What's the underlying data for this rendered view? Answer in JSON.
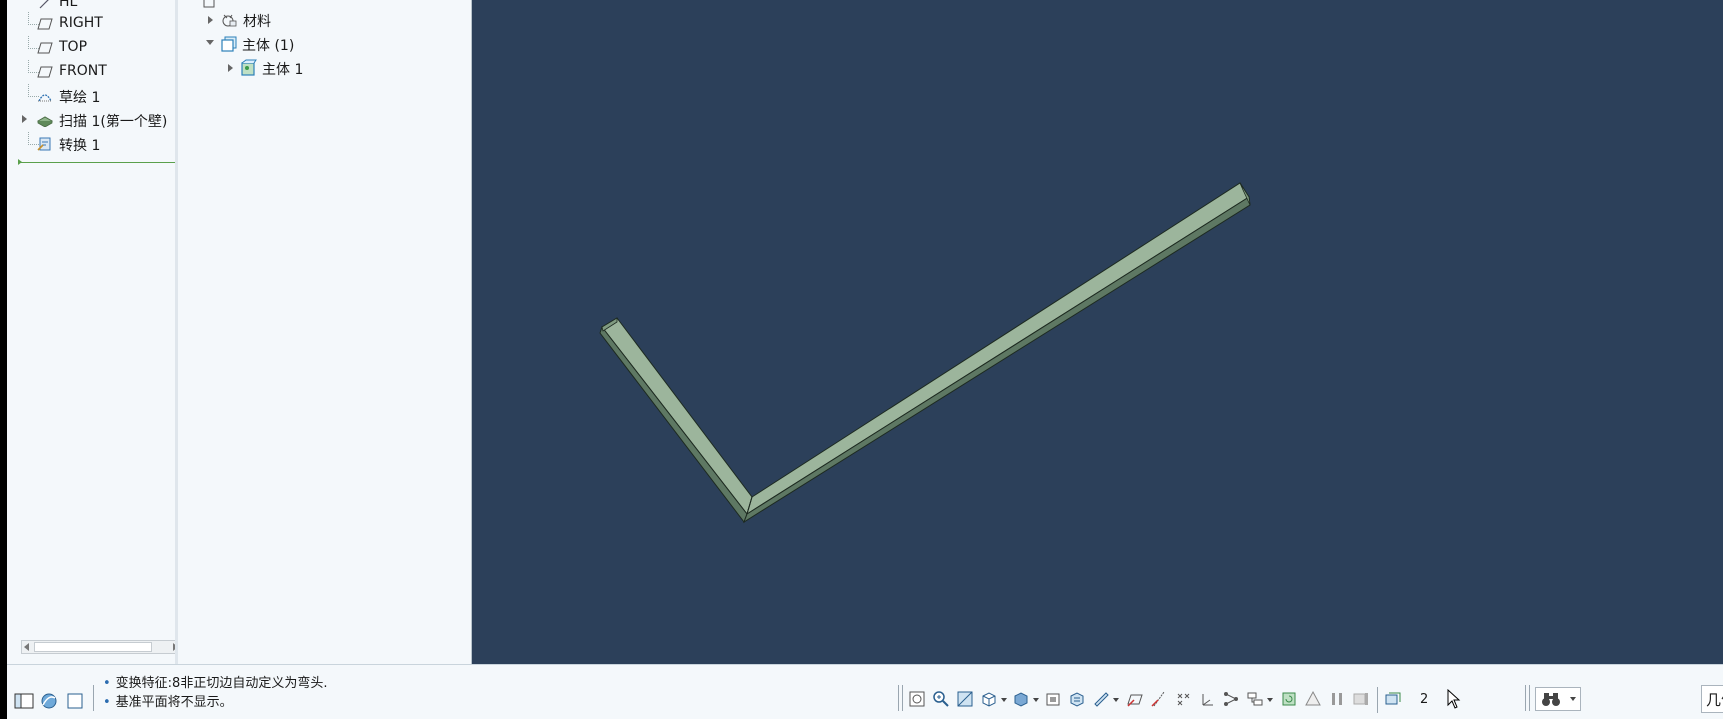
{
  "model_tree": {
    "items": [
      {
        "label": "RIGHT",
        "icon": "datum-plane-icon"
      },
      {
        "label": "TOP",
        "icon": "datum-plane-icon"
      },
      {
        "label": "FRONT",
        "icon": "datum-plane-icon"
      },
      {
        "label": "草绘 1",
        "icon": "sketch-icon"
      },
      {
        "label": "扫描 1(第一个壁)",
        "icon": "sweep-wall-icon"
      },
      {
        "label": "转换 1",
        "icon": "conversion-icon"
      }
    ],
    "top_partial_label": "HL"
  },
  "detail_tree": {
    "items": [
      {
        "label": "材料",
        "icon": "material-icon"
      },
      {
        "label": "主体 (1)",
        "icon": "bodies-icon"
      },
      {
        "label": "主体 1",
        "icon": "body-icon"
      }
    ]
  },
  "status": {
    "messages": [
      "变换特征:8非正切边自动定义为弯头.",
      "基准平面将不显示。"
    ],
    "counter": "2",
    "filter_text": "几何"
  },
  "colors": {
    "viewport_bg": "#2c405a",
    "part_face": "#9cb59c",
    "part_edge": "#1d2a20",
    "panel_bg": "#f4f8fb"
  }
}
